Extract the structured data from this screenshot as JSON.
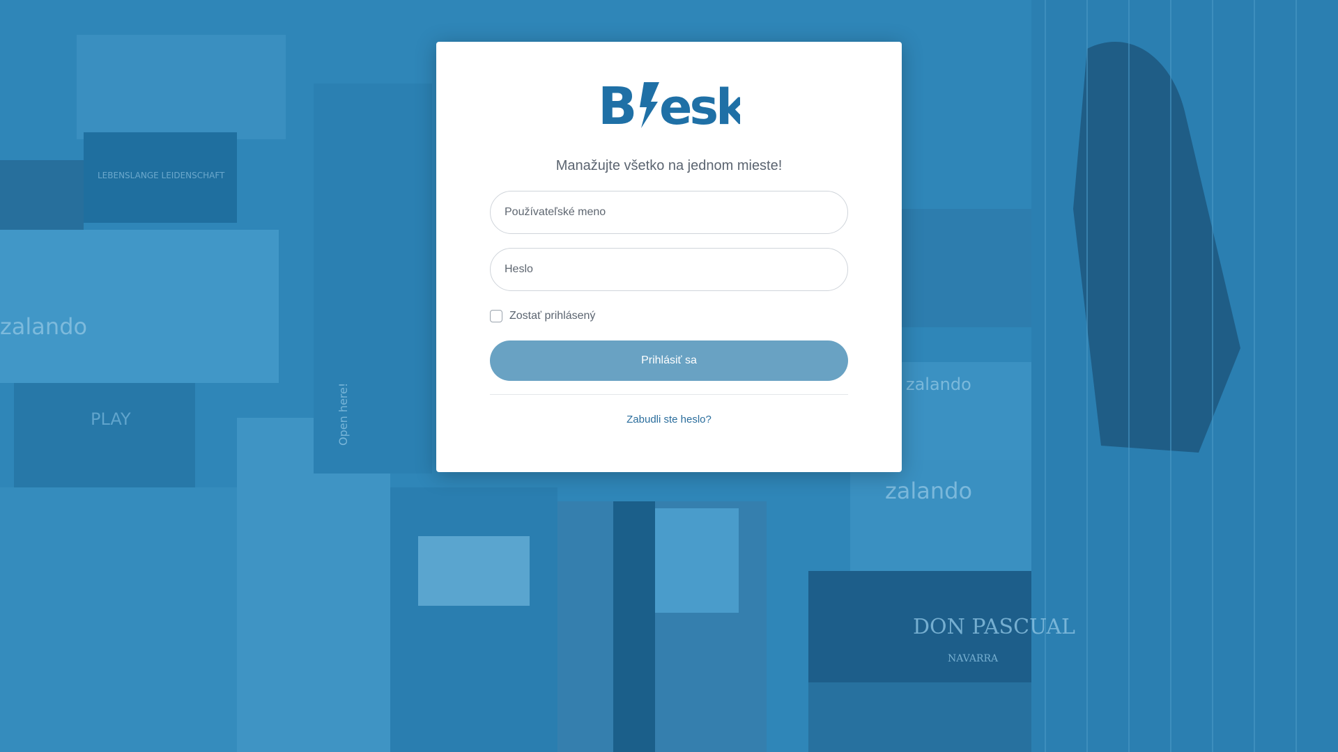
{
  "brand": {
    "logo_text": "Blesk",
    "logo_color": "#1f70a6"
  },
  "login": {
    "tagline": "Manažujte všetko na jednom mieste!",
    "username_placeholder": "Používateľské meno",
    "password_placeholder": "Heslo",
    "remember_label": "Zostať prihlásený",
    "remember_checked": false,
    "submit_label": "Prihlásiť sa",
    "forgot_label": "Zabudli ste heslo?"
  },
  "background": {
    "description_color": "#2f86b8",
    "box_labels": [
      "zalando",
      "LEBENSLANGE LEIDENSCHAFT",
      "Open here!",
      "PLAY",
      "zalando",
      "zalando",
      "DON PASCUAL",
      "NAVARRA"
    ]
  },
  "colors": {
    "accent": "#69a2c3",
    "link": "#2a6d9c",
    "overlay": "#2f86b8"
  }
}
